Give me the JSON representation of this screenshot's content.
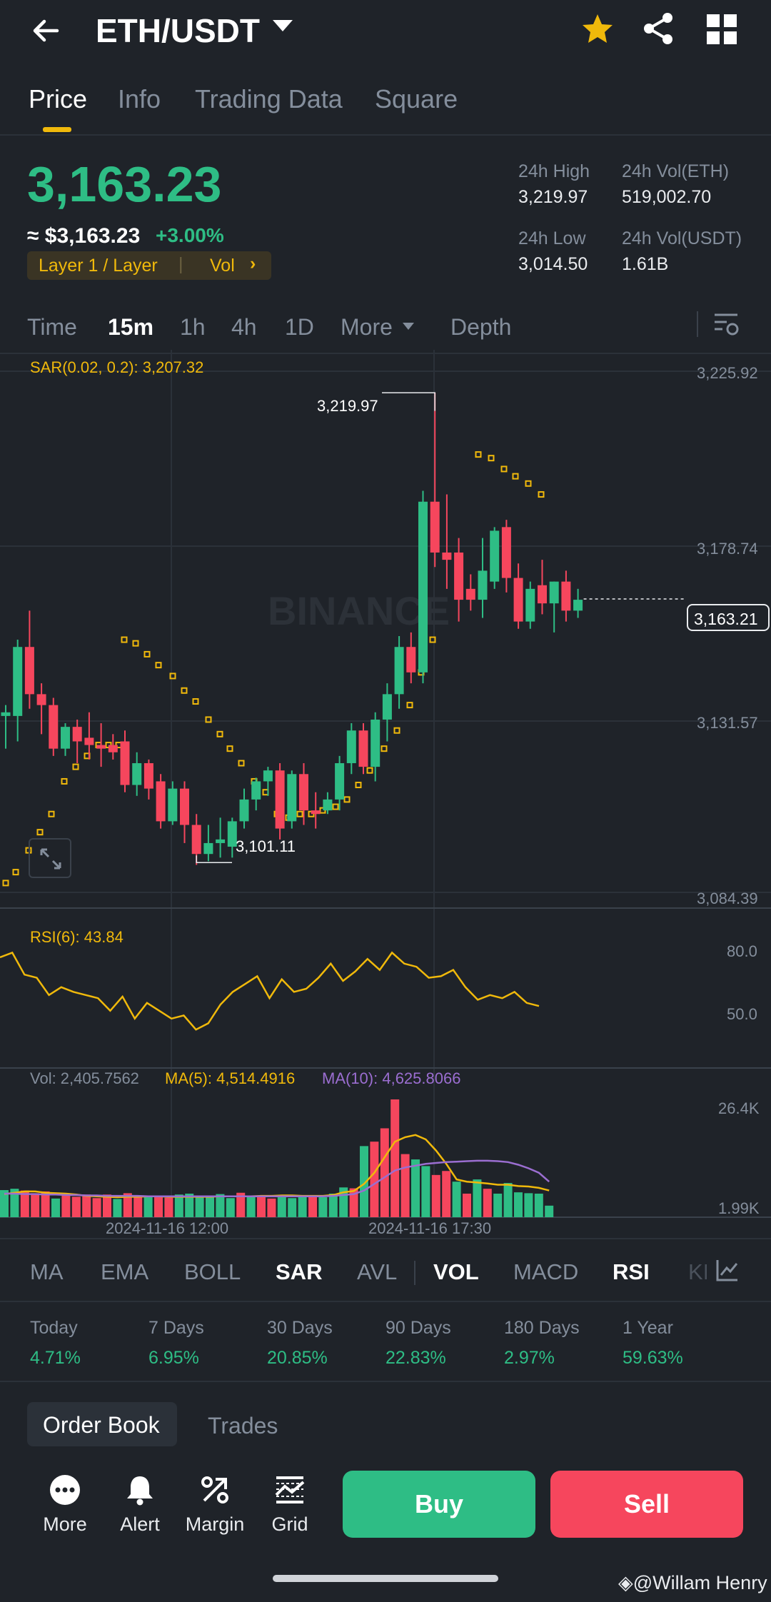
{
  "header": {
    "pair": "ETH/USDT",
    "icons": [
      "back-arrow-icon",
      "caret-down-icon",
      "star-icon",
      "share-icon",
      "grid-icon"
    ]
  },
  "tabs": [
    "Price",
    "Info",
    "Trading Data",
    "Square"
  ],
  "price": {
    "last": "3,163.23",
    "usd": "≈ $3,163.23",
    "change": "+3.00%",
    "tag": "Layer 1 / Layer",
    "tag_vol": "Vol",
    "stats": {
      "high_label": "24h High",
      "high": "3,219.97",
      "vol_eth_label": "24h Vol(ETH)",
      "vol_eth": "519,002.70",
      "low_label": "24h Low",
      "low": "3,014.50",
      "vol_usdt_label": "24h Vol(USDT)",
      "vol_usdt": "1.61B"
    }
  },
  "intervals": [
    "Time",
    "15m",
    "1h",
    "4h",
    "1D",
    "More",
    "Depth"
  ],
  "chart": {
    "sar_label": "SAR(0.02, 0.2): 3,207.32",
    "watermark": "BINANCE",
    "price_axis": [
      "3,225.92",
      "3,178.74",
      "3,131.57",
      "3,084.39"
    ],
    "current_price": "3,163.21",
    "high_marker": "3,219.97",
    "low_marker": "3,101.11",
    "rsi_label": "RSI(6): 43.84",
    "rsi_axis": [
      "80.0",
      "50.0"
    ],
    "vol_label": "Vol: 2,405.7562",
    "ma5_label": "MA(5): 4,514.4916",
    "ma10_label": "MA(10): 4,625.8066",
    "vol_axis": [
      "26.4K",
      "1.99K"
    ],
    "time_axis": [
      "2024-11-16 12:00",
      "2024-11-16 17:30"
    ]
  },
  "chart_data": {
    "type": "candlestick",
    "candles": [
      {
        "o": 3131,
        "h": 3134,
        "c": 3132,
        "l": 3122
      },
      {
        "o": 3131,
        "h": 3152,
        "c": 3150,
        "l": 3124
      },
      {
        "o": 3150,
        "h": 3160,
        "c": 3137,
        "l": 3133
      },
      {
        "o": 3137,
        "h": 3140,
        "c": 3134,
        "l": 3126
      },
      {
        "o": 3134,
        "h": 3136,
        "c": 3122,
        "l": 3120
      },
      {
        "o": 3122,
        "h": 3129,
        "c": 3128,
        "l": 3120
      },
      {
        "o": 3128,
        "h": 3130,
        "c": 3124,
        "l": 3118
      },
      {
        "o": 3125,
        "h": 3132,
        "c": 3123,
        "l": 3119
      },
      {
        "o": 3123,
        "h": 3129,
        "c": 3122,
        "l": 3117
      },
      {
        "o": 3123,
        "h": 3126,
        "c": 3121,
        "l": 3119
      },
      {
        "o": 3124,
        "h": 3127,
        "c": 3112,
        "l": 3110
      },
      {
        "o": 3112,
        "h": 3121,
        "c": 3118,
        "l": 3109
      },
      {
        "o": 3118,
        "h": 3119,
        "c": 3111,
        "l": 3108
      },
      {
        "o": 3113,
        "h": 3115,
        "c": 3102,
        "l": 3100
      },
      {
        "o": 3102,
        "h": 3113,
        "c": 3111,
        "l": 3101
      },
      {
        "o": 3111,
        "h": 3113,
        "c": 3101,
        "l": 3096
      },
      {
        "o": 3101,
        "h": 3104,
        "c": 3093,
        "l": 3090
      },
      {
        "o": 3093,
        "h": 3101,
        "c": 3096,
        "l": 3091
      },
      {
        "o": 3096,
        "h": 3103,
        "c": 3097,
        "l": 3092
      },
      {
        "o": 3095,
        "h": 3103,
        "c": 3102,
        "l": 3092
      },
      {
        "o": 3102,
        "h": 3111,
        "c": 3108,
        "l": 3100
      },
      {
        "o": 3108,
        "h": 3114,
        "c": 3113,
        "l": 3105
      },
      {
        "o": 3113,
        "h": 3117,
        "c": 3116,
        "l": 3109
      },
      {
        "o": 3116,
        "h": 3118,
        "c": 3100,
        "l": 3097
      },
      {
        "o": 3102,
        "h": 3116,
        "c": 3115,
        "l": 3100
      },
      {
        "o": 3115,
        "h": 3118,
        "c": 3105,
        "l": 3101
      },
      {
        "o": 3105,
        "h": 3110,
        "c": 3104,
        "l": 3100
      },
      {
        "o": 3105,
        "h": 3110,
        "c": 3108,
        "l": 3104
      },
      {
        "o": 3108,
        "h": 3120,
        "c": 3118,
        "l": 3105
      },
      {
        "o": 3118,
        "h": 3129,
        "c": 3127,
        "l": 3115
      },
      {
        "o": 3127,
        "h": 3129,
        "c": 3117,
        "l": 3115
      },
      {
        "o": 3117,
        "h": 3132,
        "c": 3130,
        "l": 3113
      },
      {
        "o": 3130,
        "h": 3140,
        "c": 3137,
        "l": 3124
      },
      {
        "o": 3137,
        "h": 3153,
        "c": 3150,
        "l": 3133
      },
      {
        "o": 3150,
        "h": 3154,
        "c": 3143,
        "l": 3140
      },
      {
        "o": 3143,
        "h": 3193,
        "c": 3190,
        "l": 3140
      },
      {
        "o": 3190,
        "h": 3220,
        "c": 3176,
        "l": 3172
      },
      {
        "o": 3176,
        "h": 3192,
        "c": 3174,
        "l": 3166
      },
      {
        "o": 3176,
        "h": 3180,
        "c": 3163,
        "l": 3157
      },
      {
        "o": 3166,
        "h": 3170,
        "c": 3163,
        "l": 3160
      },
      {
        "o": 3163,
        "h": 3180,
        "c": 3171,
        "l": 3158
      },
      {
        "o": 3168,
        "h": 3183,
        "c": 3182,
        "l": 3166
      },
      {
        "o": 3183,
        "h": 3185,
        "c": 3169,
        "l": 3165
      },
      {
        "o": 3169,
        "h": 3173,
        "c": 3157,
        "l": 3155
      },
      {
        "o": 3157,
        "h": 3168,
        "c": 3166,
        "l": 3155
      },
      {
        "o": 3167,
        "h": 3174,
        "c": 3162,
        "l": 3159
      },
      {
        "o": 3162,
        "h": 3168,
        "c": 3168,
        "l": 3154
      },
      {
        "o": 3168,
        "h": 3171,
        "c": 3160,
        "l": 3157
      },
      {
        "o": 3160,
        "h": 3166,
        "c": 3163,
        "l": 3158
      }
    ],
    "sar": [
      3085,
      3088,
      3094,
      3099,
      3104,
      3113,
      3117,
      3120,
      3123,
      3123,
      3123,
      3152,
      3151,
      3148,
      3145,
      3142,
      3138,
      3135,
      3130,
      3126,
      3122,
      3118,
      3113,
      3110,
      3104,
      3103,
      3104,
      3104,
      3105,
      3106,
      3108,
      3112,
      3116,
      3122,
      3127,
      3134,
      3143,
      3152,
      3203,
      3202,
      3199,
      3197,
      3195,
      3192
    ],
    "sar_offset": 0,
    "rsi": [
      75,
      78,
      64,
      62,
      51,
      56,
      53,
      51,
      49,
      41,
      50,
      36,
      46,
      41,
      36,
      38,
      29,
      33,
      45,
      53,
      58,
      63,
      49,
      61,
      53,
      55,
      62,
      71,
      60,
      66,
      74,
      67,
      78,
      71,
      69,
      62,
      63,
      67,
      56,
      48,
      51,
      49,
      53,
      46,
      44
    ],
    "volume": [
      6100,
      6400,
      6000,
      5400,
      5800,
      4200,
      5400,
      4600,
      5100,
      4300,
      5100,
      4100,
      5400,
      4900,
      4500,
      4600,
      4400,
      5100,
      5300,
      4800,
      4700,
      5200,
      4300,
      5500,
      4600,
      4800,
      4200,
      4800,
      4300,
      4800,
      4500,
      4500,
      5300,
      6700,
      6500,
      16000,
      17000,
      20000,
      26500,
      14200,
      13000,
      11500,
      9500,
      10400,
      8000,
      5300,
      8500,
      6400,
      5300,
      7700,
      5600,
      5400,
      5300,
      2600
    ],
    "ma5": [
      5200,
      5500,
      5800,
      5800,
      5500,
      5400,
      5300,
      5100,
      4800,
      4700,
      4600,
      4500,
      4600,
      4600,
      4700,
      4700,
      4600,
      4600,
      4600,
      4600,
      4600,
      4700,
      4700,
      4700,
      4700,
      4800,
      4800,
      4900,
      4900,
      4800,
      4800,
      4800,
      5000,
      5600,
      5900,
      7500,
      10000,
      13500,
      17000,
      18000,
      18500,
      17500,
      15000,
      12000,
      8500,
      8000,
      7800,
      7600,
      7300,
      7300,
      7000,
      6900,
      6600,
      6000
    ],
    "ma10": [
      5300,
      5300,
      5200,
      5200,
      5100,
      5100,
      5000,
      5000,
      4900,
      4900,
      4800,
      4800,
      4800,
      4800,
      4700,
      4700,
      4700,
      4700,
      4700,
      4700,
      4700,
      4700,
      4700,
      4700,
      4700,
      4700,
      4700,
      4700,
      4700,
      4700,
      4700,
      4700,
      4800,
      5000,
      5200,
      6000,
      7500,
      9000,
      10500,
      11200,
      11600,
      12000,
      12200,
      12400,
      12500,
      12600,
      12700,
      12700,
      12600,
      12400,
      11800,
      11000,
      10000,
      8000
    ],
    "price_range": [
      3084.39,
      3225.92
    ],
    "rsi_range": [
      30,
      80
    ]
  },
  "indicators": [
    "MA",
    "EMA",
    "BOLL",
    "SAR",
    "AVL",
    "VOL",
    "MACD",
    "RSI",
    "KI"
  ],
  "performance": [
    {
      "label": "Today",
      "value": "4.71%"
    },
    {
      "label": "7 Days",
      "value": "6.95%"
    },
    {
      "label": "30 Days",
      "value": "20.85%"
    },
    {
      "label": "90 Days",
      "value": "22.83%"
    },
    {
      "label": "180 Days",
      "value": "2.97%"
    },
    {
      "label": "1 Year",
      "value": "59.63%"
    }
  ],
  "book_tabs": [
    "Order Book",
    "Trades"
  ],
  "toolbar": [
    "More",
    "Alert",
    "Margin",
    "Grid"
  ],
  "buy_label": "Buy",
  "sell_label": "Sell",
  "watermark_text": "@Willam Henry",
  "colors": {
    "up": "#2ebd85",
    "down": "#f6465d",
    "accent": "#f0b90b",
    "ma10": "#9b6ed1"
  }
}
